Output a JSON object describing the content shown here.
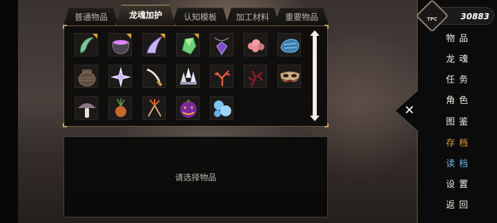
{
  "tabs": [
    {
      "label": "普通物品",
      "active": false
    },
    {
      "label": "龙魂加护",
      "active": true
    },
    {
      "label": "认知模板",
      "active": false
    },
    {
      "label": "加工材料",
      "active": false
    },
    {
      "label": "重要物品",
      "active": false
    }
  ],
  "inventory": {
    "items": [
      {
        "icon": "green-horn-icon",
        "new": true
      },
      {
        "icon": "purple-cauldron-icon",
        "new": true
      },
      {
        "icon": "purple-claw-icon",
        "new": true
      },
      {
        "icon": "green-crystal-icon",
        "new": true
      },
      {
        "icon": "purple-pendant-icon",
        "new": false
      },
      {
        "icon": "pink-coral-icon",
        "new": false
      },
      {
        "icon": "blue-ore-icon",
        "new": false
      },
      {
        "icon": "clay-pot-icon",
        "new": false
      },
      {
        "icon": "white-star-burst-icon",
        "new": false
      },
      {
        "icon": "curved-dagger-icon",
        "new": false
      },
      {
        "icon": "white-crystal-cluster-icon",
        "new": false
      },
      {
        "icon": "red-coral-branch-icon",
        "new": false
      },
      {
        "icon": "dark-red-coral-icon",
        "new": false
      },
      {
        "icon": "masquerade-mask-icon",
        "new": false
      },
      {
        "icon": "mushroom-icon",
        "new": false
      },
      {
        "icon": "onion-bulb-icon",
        "new": false
      },
      {
        "icon": "herb-root-icon",
        "new": false
      },
      {
        "icon": "jack-o-lantern-icon",
        "new": false
      },
      {
        "icon": "blue-slime-icon",
        "new": false
      }
    ]
  },
  "description": {
    "placeholder": "请选择物品"
  },
  "currency": {
    "value": "30883",
    "emblem_text": "TPC"
  },
  "close": {
    "symbol": "✕"
  },
  "menu": [
    {
      "label": "物品",
      "style": "normal"
    },
    {
      "label": "龙魂",
      "style": "normal"
    },
    {
      "label": "任务",
      "style": "normal"
    },
    {
      "label": "角色",
      "style": "normal"
    },
    {
      "label": "图鉴",
      "style": "normal"
    },
    {
      "label": "存档",
      "style": "save"
    },
    {
      "label": "读档",
      "style": "load"
    },
    {
      "label": "设置",
      "style": "normal"
    },
    {
      "label": "返回",
      "style": "normal"
    }
  ],
  "colors": {
    "accent_gold": "#c7a46a",
    "new_badge": "#e1a42c",
    "save": "#e39a35",
    "load": "#6fb6e6"
  }
}
